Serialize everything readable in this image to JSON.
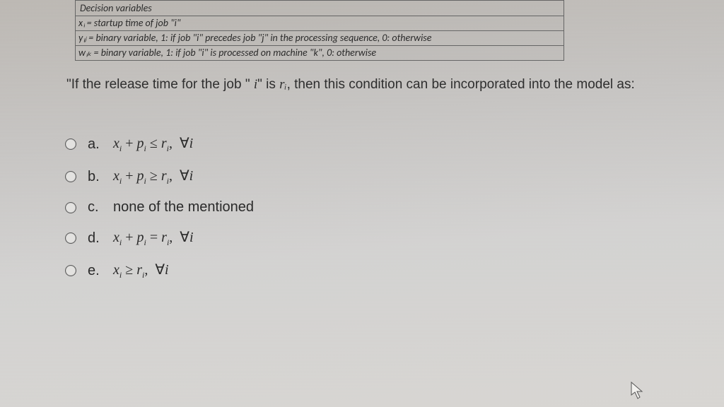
{
  "box": {
    "header": "Decision variables",
    "rows": [
      "xᵢ = startup time of job \"i\"",
      "yᵢⱼ = binary variable, 1: if job \"i\" precedes job \"j\" in the processing sequence, 0: otherwise",
      "wᵢₖ = binary variable, 1: if job \"i\" is processed on machine \"k\", 0: otherwise"
    ]
  },
  "question": {
    "prefix": "\"If the release time for the job \" ",
    "ivar": "i",
    "mid": "\" is ",
    "rvar": "rᵢ",
    "suffix": ", then this condition can be incorporated into the model as:"
  },
  "options": {
    "a": {
      "letter": "a.",
      "text_html": "xᵢ + pᵢ ≤ rᵢ,  ∀i"
    },
    "b": {
      "letter": "b.",
      "text_html": "xᵢ + pᵢ ≥ rᵢ,  ∀i"
    },
    "c": {
      "letter": "c.",
      "text_plain": "none of the mentioned"
    },
    "d": {
      "letter": "d.",
      "text_html": "xᵢ + pᵢ = rᵢ,  ∀i"
    },
    "e": {
      "letter": "e.",
      "text_html": "xᵢ ≥ rᵢ,  ∀i"
    }
  }
}
